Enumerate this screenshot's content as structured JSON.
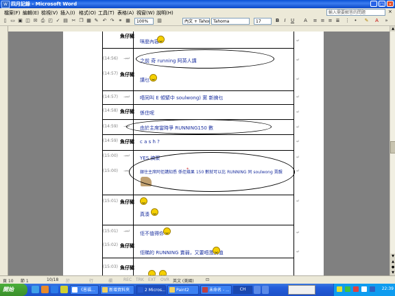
{
  "window": {
    "title": "四月記錄 - Microsoft Word",
    "help_placeholder": "輸入需要解答的問題"
  },
  "menu": [
    "檔案(F)",
    "編輯(E)",
    "檢視(V)",
    "插入(I)",
    "格式(O)",
    "工具(T)",
    "表格(A)",
    "視窗(W)",
    "說明(H)"
  ],
  "toolbar": {
    "zoom": "100%",
    "style": "內文 + Tahom",
    "font": "Tahoma",
    "size": "17"
  },
  "chat": [
    {
      "time": "",
      "name": "",
      "text": "咪麼內容"
    },
    {
      "time": "(14:56)",
      "name": "",
      "text": "之前 奇 running 阿英人講"
    },
    {
      "time": "(14:57)",
      "name": "魚仔豬",
      "text": "講乜"
    },
    {
      "time": "(14:57)",
      "name": "",
      "text": "唔同叫 E 傾緊中 soulwong) 黨 新搞乜"
    },
    {
      "time": "(14:58)",
      "name": "魚仔豬",
      "text": "係住呢"
    },
    {
      "time": "(14:59)",
      "name": "",
      "text": "由於主席當時爭 RUNNING150 數"
    },
    {
      "time": "(14:59)",
      "name": "魚仔豬",
      "text": "c a s h ?"
    },
    {
      "time": "(15:00)",
      "name": "",
      "text": "YES 搞聚"
    },
    {
      "time": "(15:00)",
      "name": "",
      "text": "銀住主席阿佢講知悉 係佢幾果 150 數就可以比 RUNNING 同 soulwong 賣靚"
    },
    {
      "time": "(15:01)",
      "name": "魚仔豬",
      "text": ""
    },
    {
      "time": "",
      "name": "",
      "text": "真湊"
    },
    {
      "time": "(15:01)",
      "name": "",
      "text": "佢不值得你"
    },
    {
      "time": "(15:02)",
      "name": "魚仔豬",
      "text": "佢睇的 RUNNING 賣弱，又要唔激搞值"
    },
    {
      "time": "(15:03)",
      "name": "魚仔豬",
      "text": ""
    }
  ],
  "status": {
    "page": "頁 10",
    "section": "節 1",
    "pages": "10/18",
    "at": "於",
    "line": "行",
    "col": "欄",
    "rec": "REC",
    "trk": "TRK",
    "ext": "EXT",
    "ovr": "OVR",
    "lang": "英文 (美國)"
  },
  "taskbar": {
    "start": "開始",
    "tasks": [
      "《恩福...",
      "新增資料夾",
      "2 Micros...",
      "Paint2",
      "未命名 - ..."
    ],
    "clock": "22:39",
    "tray_lang": "CH"
  }
}
